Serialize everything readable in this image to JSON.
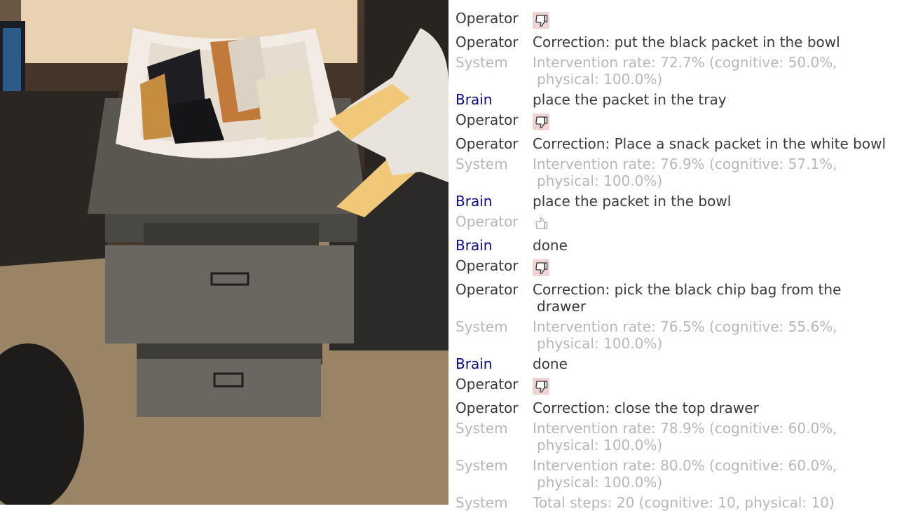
{
  "camera": {
    "label": "Robot camera view"
  },
  "log": [
    {
      "who": "Operator",
      "kind": "operator",
      "icon": "thumbs-down"
    },
    {
      "who": "Operator",
      "kind": "operator",
      "text": "Correction: put the black packet in the bowl"
    },
    {
      "who": "System",
      "kind": "system",
      "line1": "Intervention rate: 72.7% (cognitive: 50.0%,",
      "line2": "physical: 100.0%)"
    },
    {
      "who": "Brain",
      "kind": "brain",
      "text": "place the packet in the tray"
    },
    {
      "who": "Operator",
      "kind": "operator",
      "icon": "thumbs-down"
    },
    {
      "who": "Operator",
      "kind": "operator",
      "text": "Correction: Place a snack packet in the white bowl"
    },
    {
      "who": "System",
      "kind": "system",
      "line1": "Intervention rate: 76.9% (cognitive: 57.1%,",
      "line2": "physical: 100.0%)"
    },
    {
      "who": "Brain",
      "kind": "brain",
      "text": "place the packet in the bowl"
    },
    {
      "who": "Operator",
      "kind": "faded",
      "icon": "thumbs-up"
    },
    {
      "who": "Brain",
      "kind": "brain",
      "text": "done"
    },
    {
      "who": "Operator",
      "kind": "operator",
      "icon": "thumbs-down"
    },
    {
      "who": "Operator",
      "kind": "operator",
      "line1": "Correction: pick the black chip bag from the",
      "line2": "drawer"
    },
    {
      "who": "System",
      "kind": "system",
      "line1": "Intervention rate: 76.5% (cognitive: 55.6%,",
      "line2": "physical: 100.0%)"
    },
    {
      "who": "Brain",
      "kind": "brain",
      "text": "done"
    },
    {
      "who": "Operator",
      "kind": "operator",
      "icon": "thumbs-down"
    },
    {
      "who": "Operator",
      "kind": "operator",
      "text": "Correction: close the top drawer"
    },
    {
      "who": "System",
      "kind": "system",
      "line1": "Intervention rate: 78.9% (cognitive: 60.0%,",
      "line2": "physical: 100.0%)"
    },
    {
      "who": "System",
      "kind": "system",
      "line1": "Intervention rate: 80.0% (cognitive: 60.0%,",
      "line2": "physical: 100.0%)"
    },
    {
      "who": "System",
      "kind": "system",
      "text": "Total steps: 20 (cognitive: 10, physical: 10)"
    }
  ],
  "colors": {
    "brain_label": "#0a0a8c",
    "operator_text": "#3a3a3a",
    "system_text": "#b8b8b8",
    "thumbs_down_bg": "#f0d4d4"
  }
}
